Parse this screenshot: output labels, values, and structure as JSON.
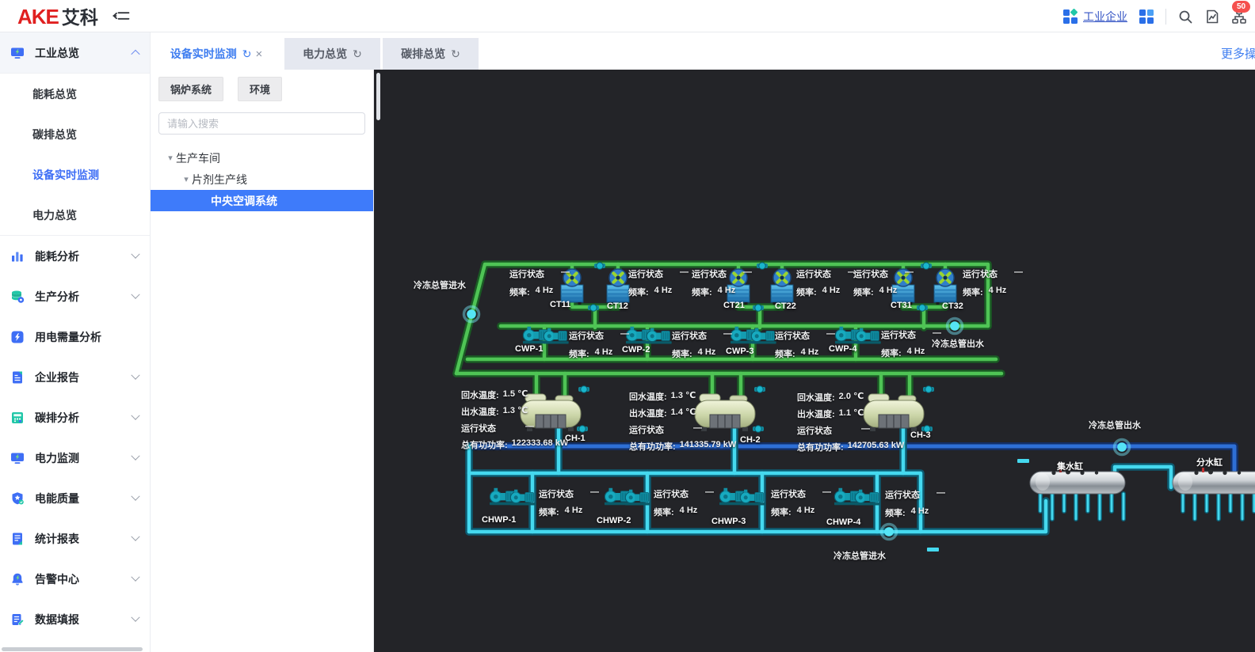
{
  "header": {
    "logo_text_red": "AKE",
    "logo_text_dark": "艾科",
    "org_link": "工业企业",
    "alarm_badge": "50"
  },
  "icons": {
    "refresh": "↻",
    "close": "×",
    "caret": "▾"
  },
  "tab_bar": {
    "tabs": [
      {
        "label": "设备实时监测"
      },
      {
        "label": "电力总览"
      },
      {
        "label": "碳排总览"
      }
    ],
    "more_link": "更多操作"
  },
  "sidebar": {
    "items": [
      {
        "label": "工业总览"
      },
      {
        "label": "能耗总览"
      },
      {
        "label": "碳排总览"
      },
      {
        "label": "设备实时监测"
      },
      {
        "label": "电力总览"
      },
      {
        "label": "能耗分析"
      },
      {
        "label": "生产分析"
      },
      {
        "label": "用电需量分析"
      },
      {
        "label": "企业报告"
      },
      {
        "label": "碳排分析"
      },
      {
        "label": "电力监测"
      },
      {
        "label": "电能质量"
      },
      {
        "label": "统计报表"
      },
      {
        "label": "告警中心"
      },
      {
        "label": "数据填报"
      }
    ]
  },
  "panel": {
    "filter_buttons": [
      {
        "label": "锅炉系统"
      },
      {
        "label": "环境"
      }
    ],
    "search_placeholder": "请输入搜索",
    "tree": [
      {
        "label": "生产车间"
      },
      {
        "label": "片剂生产线"
      },
      {
        "label": "中央空调系统"
      }
    ]
  },
  "diagram": {
    "strings": {
      "run_status": "运行状态",
      "status_value": "—",
      "freq_label": "频率:",
      "freq_value": "4 Hz",
      "return_temp_label": "回水温度:",
      "supply_temp_label": "出水温度:",
      "power_label": "总有功功率:"
    },
    "pipe_labels": {
      "left_inlet": "冷冻总管进水",
      "mid_outlet": "冷冻总管出水",
      "right_outlet": "冷冻总管出水",
      "bottom_inlet": "冷冻总管进水"
    },
    "towers": [
      {
        "name": "CT11"
      },
      {
        "name": "CT12"
      },
      {
        "name": "CT21"
      },
      {
        "name": "CT22"
      },
      {
        "name": "CT31"
      },
      {
        "name": "CT32"
      }
    ],
    "cwp_pumps": [
      {
        "name": "CWP-1"
      },
      {
        "name": "CWP-2"
      },
      {
        "name": "CWP-3"
      },
      {
        "name": "CWP-4"
      }
    ],
    "chwp_pumps": [
      {
        "name": "CHWP-1"
      },
      {
        "name": "CHWP-2"
      },
      {
        "name": "CHWP-3"
      },
      {
        "name": "CHWP-4"
      }
    ],
    "chillers": [
      {
        "name": "CH-1",
        "return_temp": "1.5 ℃",
        "supply_temp": "1.3 ℃",
        "power": "122333.68 kW"
      },
      {
        "name": "CH-2",
        "return_temp": "1.3 ℃",
        "supply_temp": "1.4 ℃",
        "power": "141335.79 kW"
      },
      {
        "name": "CH-3",
        "return_temp": "2.0 ℃",
        "supply_temp": "1.1 ℃",
        "power": "142705.63 kW"
      }
    ],
    "tanks": [
      {
        "name": "集水缸"
      },
      {
        "name": "分水缸"
      }
    ]
  }
}
